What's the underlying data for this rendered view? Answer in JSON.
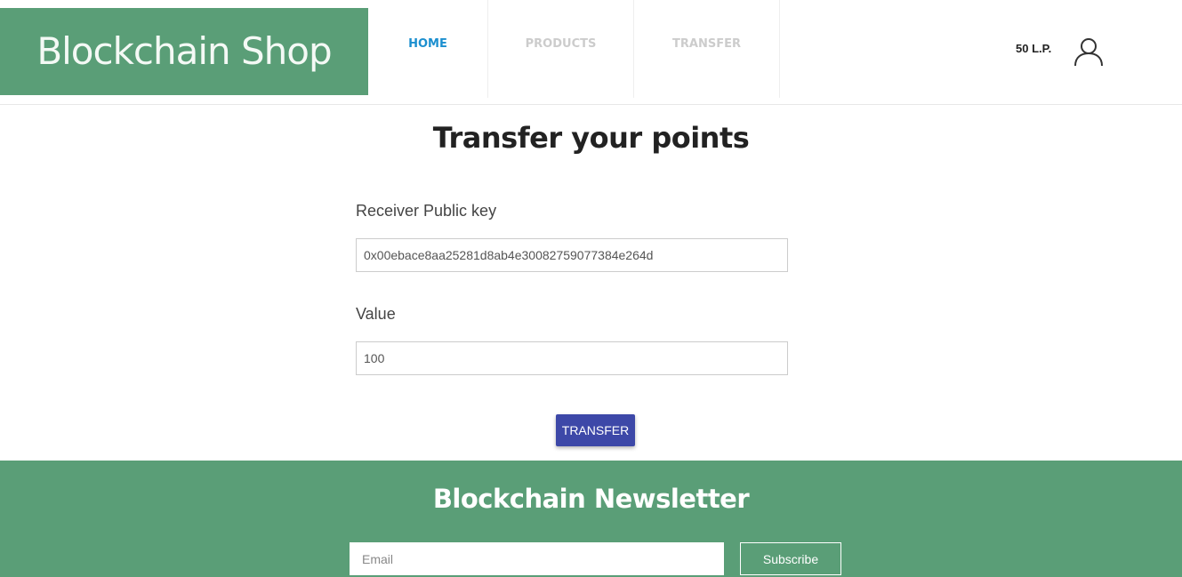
{
  "header": {
    "logo_text": "Blockchain Shop",
    "nav": [
      {
        "label": "HOME",
        "active": true
      },
      {
        "label": "PRODUCTS",
        "active": false
      },
      {
        "label": "TRANSFER",
        "active": false
      }
    ],
    "points_balance": "50 L.P.",
    "user_icon": "user-icon"
  },
  "main": {
    "title": "Transfer your points",
    "receiver_label": "Receiver Public key",
    "receiver_value": "0x00ebace8aa25281d8ab4e30082759077384e264d",
    "value_label": "Value",
    "value_value": "100",
    "transfer_button": "TRANSFER"
  },
  "footer": {
    "title": "Blockchain Newsletter",
    "email_placeholder": "Email",
    "email_value": "",
    "subscribe_button": "Subscribe"
  },
  "colors": {
    "brand_green": "#5a9e77",
    "active_nav": "#1c8fcf",
    "inactive_nav": "#cccccc",
    "button_blue": "#3d48a8"
  }
}
